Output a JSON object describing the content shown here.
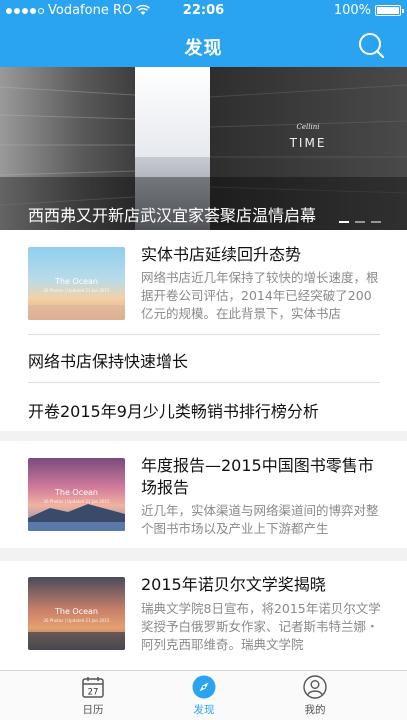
{
  "status_bar": {
    "carrier": "Vodafone RO",
    "time": "22:06",
    "battery": "100%"
  },
  "nav": {
    "title": "发现"
  },
  "banner": {
    "caption": "西西弗又开新店武汉宜家荟聚店温情启幕",
    "image_text_brand": "Cellini",
    "image_text_title": "TIME",
    "slide_count": 3,
    "active_slide": 0
  },
  "articles": [
    {
      "title": "实体书店延续回升态势",
      "desc": "网络书店近几年保持了较快的增长速度，根据开卷公司评估，2014年已经突破了200亿元的规模。在此背景下，实体书店",
      "thumb_title": "The Ocean",
      "thumb_sub": "26 Photos | Updated 21 Jan 2015"
    },
    {
      "title": "网络书店保持快速增长"
    },
    {
      "title": "开卷2015年9月少儿类畅销书排行榜分析"
    },
    {
      "title": "年度报告—2015中国图书零售市场报告",
      "desc": "近几年，实体渠道与网络渠道间的博弈对整个图书市场以及产业上下游都产生",
      "thumb_title": "The Ocean",
      "thumb_sub": "26 Photos | Updated 21 Jan 2015"
    },
    {
      "title": "2015年诺贝尔文学奖揭晓",
      "desc": "瑞典文学院8日宣布，将2015年诺贝尔文学奖授予白俄罗斯女作家、记者斯韦特兰娜・阿列克西耶维奇。瑞典文学院",
      "thumb_title": "The Ocean",
      "thumb_sub": "26 Photos | Updated 21 Jan 2015"
    }
  ],
  "tabbar": {
    "calendar_day": "27",
    "items": [
      {
        "label": "日历"
      },
      {
        "label": "发现"
      },
      {
        "label": "我的"
      }
    ],
    "active_index": 1
  },
  "colors": {
    "accent": "#2aa3f0",
    "text_secondary": "#8a8a8a"
  }
}
